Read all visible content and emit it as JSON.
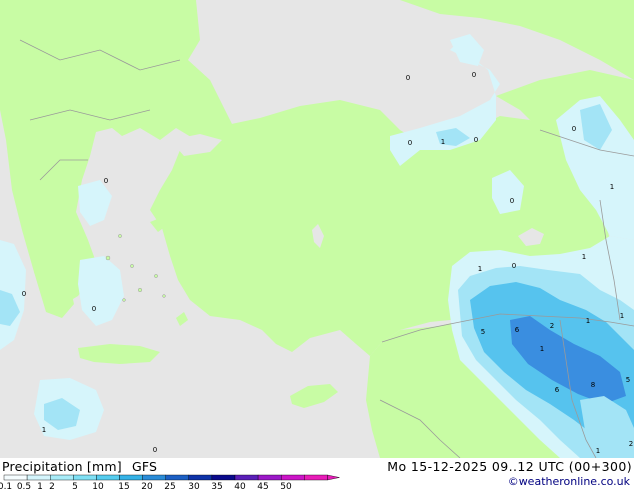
{
  "header": {
    "variable_label": "Precipitation [mm]",
    "model": "GFS",
    "valid_time": "Mo 15-12-2025 09..12 UTC (00+300)",
    "credit": "©weatheronline.co.uk"
  },
  "legend": {
    "unit": "mm",
    "ticks": [
      "0.1",
      "0.5",
      "1",
      "2",
      "5",
      "10",
      "15",
      "20",
      "25",
      "30",
      "35",
      "40",
      "45",
      "50"
    ],
    "colors": [
      "#f5fdff",
      "#d4f5fc",
      "#a8ecf8",
      "#7fe0f4",
      "#56cdef",
      "#35b2e6",
      "#2a8cd8",
      "#1c5fc4",
      "#0e33a8",
      "#0a0a8c",
      "#5a1fb8",
      "#9b18c8",
      "#cc14c8",
      "#e81cb8"
    ]
  },
  "map": {
    "colors": {
      "sea": "#e6e6e6",
      "land": "#c8fca4",
      "border": "#9a9a9a",
      "rain_light": "#d6f5fb",
      "rain_medium": "#a3e4f6",
      "rain_heavy": "#56c3ee",
      "rain_max": "#3a8ee0"
    },
    "point_values": [
      "0",
      "0",
      "0",
      "1",
      "0",
      "0",
      "0",
      "1",
      "0",
      "0",
      "1",
      "0",
      "0",
      "1",
      "1",
      "1",
      "5",
      "6",
      "2",
      "1",
      "6",
      "8",
      "5",
      "2",
      "1",
      "1",
      "0"
    ]
  }
}
